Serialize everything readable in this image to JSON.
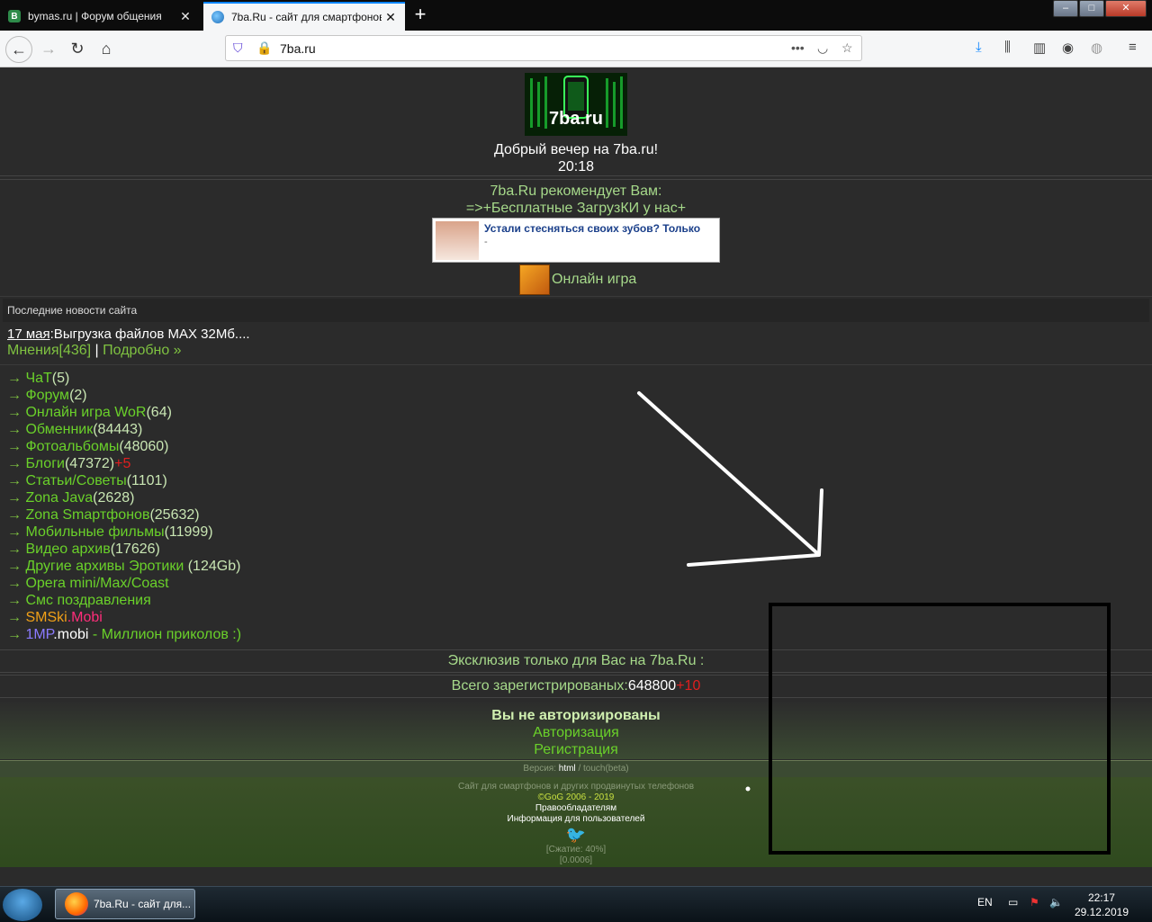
{
  "browser": {
    "tabs": [
      {
        "title": "bymas.ru | Форум общения",
        "favicon": "В"
      },
      {
        "title": "7ba.Ru - сайт для смартфонов",
        "favicon": ""
      }
    ],
    "new_tab": "+",
    "url": "7ba.ru",
    "window_controls": {
      "minimize": "–",
      "maximize": "□",
      "close": "✕"
    }
  },
  "page": {
    "logo_text": "7ba.ru",
    "greeting": "Добрый вечер на 7ba.ru!",
    "time": "20:18",
    "recommend_title": "7ba.Ru рекомендует Вам:",
    "recommend_link": "=>+Бесплатные ЗагрузКИ у нас+",
    "ad_text": "Устали стесняться своих зубов? Только",
    "ad_sub": "-",
    "game_link": "Онлайн игра",
    "news_header": "Последние новости сайта",
    "news_date": "17 мая",
    "news_text": ":Выгрузка файлов MAX 32Мб....",
    "news_opinions": "Мнения[436]",
    "news_separator": "|",
    "news_more": "Подробно »",
    "list": [
      {
        "arrow": "→",
        "label": "ЧаТ",
        "count": "(5)"
      },
      {
        "arrow": "→",
        "label": "Форум",
        "count": "(2)"
      },
      {
        "arrow": "→",
        "label": "Онлайн игра WoR",
        "count": "(64)"
      },
      {
        "arrow": "→",
        "label": "Обменник",
        "count": "(84443)"
      },
      {
        "arrow": "→",
        "label": "Фотоальбомы",
        "count": "(48060)"
      },
      {
        "arrow": "→",
        "label": "Блоги",
        "count": "(47372)",
        "extra": "+5"
      },
      {
        "arrow": "→",
        "label": "Статьи/Советы",
        "count": "(1101)"
      },
      {
        "arrow": "→",
        "label": "Zona Java",
        "count": "(2628)"
      },
      {
        "arrow": "→",
        "label": "Zona Smартфонов",
        "count": "(25632)"
      },
      {
        "arrow": "→",
        "label": "Мобильные фильмы",
        "count": "(11999)"
      },
      {
        "arrow": "→",
        "label": "Видео архив",
        "count": "(17626)"
      },
      {
        "arrow": "→",
        "label": "Другие архивы Эротики",
        "count": " (124Gb)"
      },
      {
        "arrow": "→",
        "label": "Opera mini/Max/Coast",
        "count": ""
      },
      {
        "arrow": "→",
        "label": "Смс поздравления",
        "count": ""
      }
    ],
    "smski": {
      "arrow": "→",
      "a": "SMSki",
      "b": ".Mobi"
    },
    "onemp": {
      "arrow": "→",
      "a": "1MP",
      "b": ".mobi",
      "c": " - Миллион приколов :)"
    },
    "exclusive": "Эксклюзив только для Вас на 7ba.Ru :",
    "registered_label": "Всего зарегистрированых:",
    "registered_count": "648800",
    "registered_new": "+10",
    "auth_title": "Вы не авторизированы",
    "auth_login": "Авторизация",
    "auth_register": "Регистрация",
    "version_label": "Версия:",
    "version_html": "html",
    "version_touch": " / touch(beta)",
    "footer_desc": "Сайт для смартфонов и других продвинутых телефонов",
    "footer_copy": "©GoG 2006 - 2019",
    "footer_rights": "Правообладателям",
    "footer_info": "Информация для пользователей",
    "footer_compress": "[Сжатие: 40%]",
    "footer_time": "[0.0006]"
  },
  "taskbar": {
    "app_title": "7ba.Ru - сайт для...",
    "lang": "EN",
    "time": "22:17",
    "date": "29.12.2019"
  }
}
